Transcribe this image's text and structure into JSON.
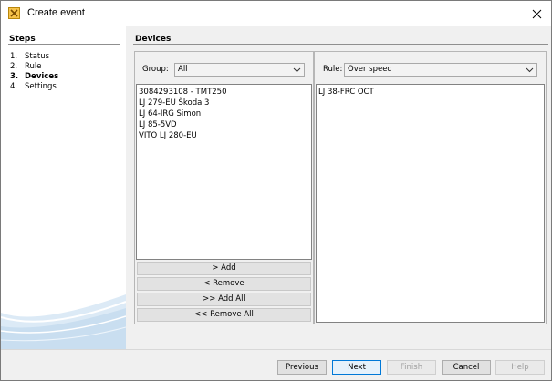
{
  "window": {
    "title": "Create event"
  },
  "steps": {
    "header": "Steps",
    "items": [
      {
        "num": "1.",
        "label": "Status"
      },
      {
        "num": "2.",
        "label": "Rule"
      },
      {
        "num": "3.",
        "label": "Devices",
        "current": true
      },
      {
        "num": "4.",
        "label": "Settings"
      }
    ]
  },
  "devices": {
    "header": "Devices",
    "group": {
      "label": "Group:",
      "value": "All"
    },
    "rule": {
      "label": "Rule:",
      "value": "Over speed"
    },
    "available": [
      "3084293108 - TMT250",
      "LJ 279-EU Škoda 3",
      "LJ 64-IRG Simon",
      "LJ 85-5VD",
      "VITO LJ 280-EU"
    ],
    "selected": [
      "LJ 38-FRC OCT"
    ],
    "buttons": {
      "add": "> Add",
      "remove": "< Remove",
      "add_all": ">> Add All",
      "remove_all": "<< Remove All"
    }
  },
  "footer": {
    "previous": "Previous",
    "next": "Next",
    "finish": "Finish",
    "cancel": "Cancel",
    "help": "Help"
  },
  "colors": {
    "accent": "#0078d7",
    "swoosh": "#cfe2f1"
  }
}
